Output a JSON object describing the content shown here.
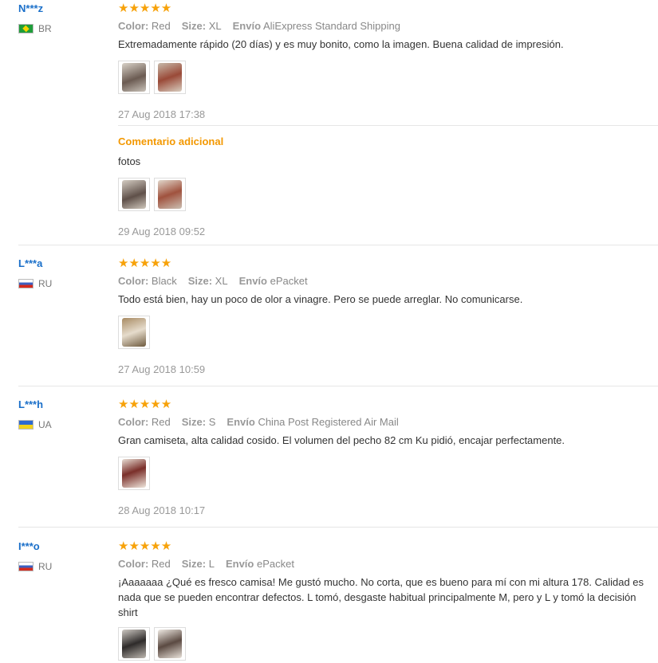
{
  "labels": {
    "color": "Color:",
    "size": "Size:",
    "shipping": "Envío",
    "additional": "Comentario adicional"
  },
  "stars": "★★★★★",
  "reviews": [
    {
      "user": "N***z",
      "country": "BR",
      "color": "Red",
      "size": "XL",
      "shipping": "AliExpress Standard Shipping",
      "text": "Extremadamente rápido (20 días) y es muy bonito, como la imagen. Buena calidad de impresión.",
      "date": "27 Aug 2018 17:38",
      "additional": {
        "text": "fotos",
        "date": "29 Aug 2018 09:52"
      }
    },
    {
      "user": "L***a",
      "country": "RU",
      "color": "Black",
      "size": "XL",
      "shipping": "ePacket",
      "text": "Todo está bien, hay un poco de olor a vinagre. Pero se puede arreglar. No comunicarse.",
      "date": "27 Aug 2018 10:59"
    },
    {
      "user": "L***h",
      "country": "UA",
      "color": "Red",
      "size": "S",
      "shipping": "China Post Registered Air Mail",
      "text": "Gran camiseta, alta calidad cosido. El volumen del pecho 82 cm Ku pidió, encajar perfectamente.",
      "date": "28 Aug 2018 10:17"
    },
    {
      "user": "I***o",
      "country": "RU",
      "color": "Red",
      "size": "L",
      "shipping": "ePacket",
      "text_lines": [
        "¡Aaaaaaa ¿Qué es fresco camisa! Me gustó mucho. No corta, que es bueno para mí con mi altura 178. Calidad es",
        "nada que se pueden encontrar defectos. L tomó, desgaste habitual principalmente M, pero y L y tomó la decisión",
        "shirt"
      ]
    }
  ],
  "colors": {
    "username": "#1a6fc9",
    "stars": "#f7a20a",
    "additional_title": "#f39800"
  }
}
